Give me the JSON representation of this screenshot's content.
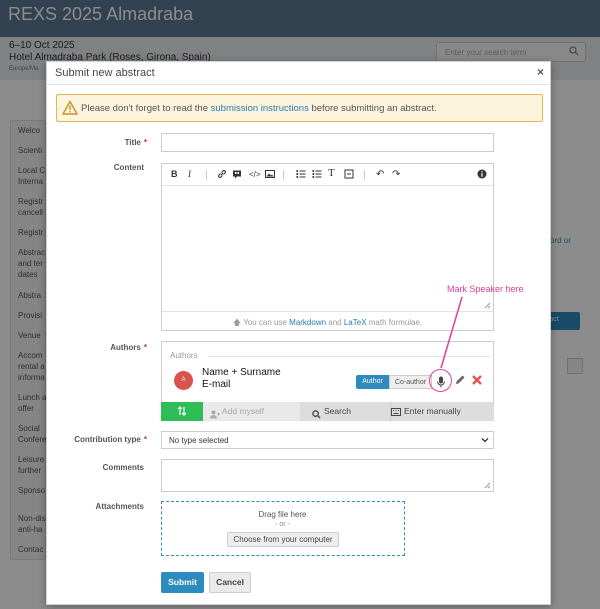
{
  "background": {
    "site_title": "REXS 2025 Almadraba",
    "dates": "6–10 Oct 2025",
    "venue": "Hotel Almadraba Park (Roses, Girona, Spain)",
    "timezone": "Europe/Ma",
    "search_placeholder": "Enter your search term",
    "nav_items": [
      "Welco",
      "Scienti",
      "Local C",
      "Interna",
      "Registr",
      "cancell",
      "Registr",
      "Abstrac",
      "and ter",
      "dates",
      "Abstra",
      "Provisi",
      "Venue",
      "Accom",
      "rental a",
      "informa",
      "Lunch a",
      "offer",
      "Social",
      "Confere",
      "Leisure",
      "further",
      "Sponso",
      "Non-dis",
      "anti-ha",
      "Contac"
    ],
    "right_link": "ord or",
    "right_button": "ract"
  },
  "modal": {
    "title": "Submit new abstract",
    "close": "×"
  },
  "warning": {
    "prefix": "Please don't forget to read the ",
    "link": "submission instructions",
    "suffix": " before submitting an abstract."
  },
  "form": {
    "title_label": "Title",
    "content_label": "Content",
    "authors_label": "Authors",
    "contribution_label": "Contribution type",
    "comments_label": "Comments",
    "attachments_label": "Attachments",
    "required_mark": "*"
  },
  "editor": {
    "footer_prefix": "You can use ",
    "markdown": "Markdown",
    "footer_and": " and ",
    "latex": "LaTeX",
    "footer_suffix": " math formulae."
  },
  "authors": {
    "legend": "Authors",
    "avatar_initial": "A",
    "name": "Name + Surname",
    "email": "E-mail",
    "role_author": "Author",
    "role_coauthor": "Co-author",
    "add_myself": "Add myself",
    "search": "Search",
    "enter_manually": "Enter manually"
  },
  "contribution_type": {
    "selected": "No type selected"
  },
  "attachments": {
    "drag_text": "Drag file here",
    "or_text": "- or -",
    "choose_button": "Choose from your computer"
  },
  "actions": {
    "submit": "Submit",
    "cancel": "Cancel"
  },
  "annotation": {
    "text": "Mark Speaker here",
    "color": "#e0409a"
  },
  "colors": {
    "primary": "#2d8bbd",
    "green": "#2ebd56",
    "warning_bg": "#fcf4dc",
    "warning_border": "#e3b451",
    "remove": "#e0544f"
  }
}
